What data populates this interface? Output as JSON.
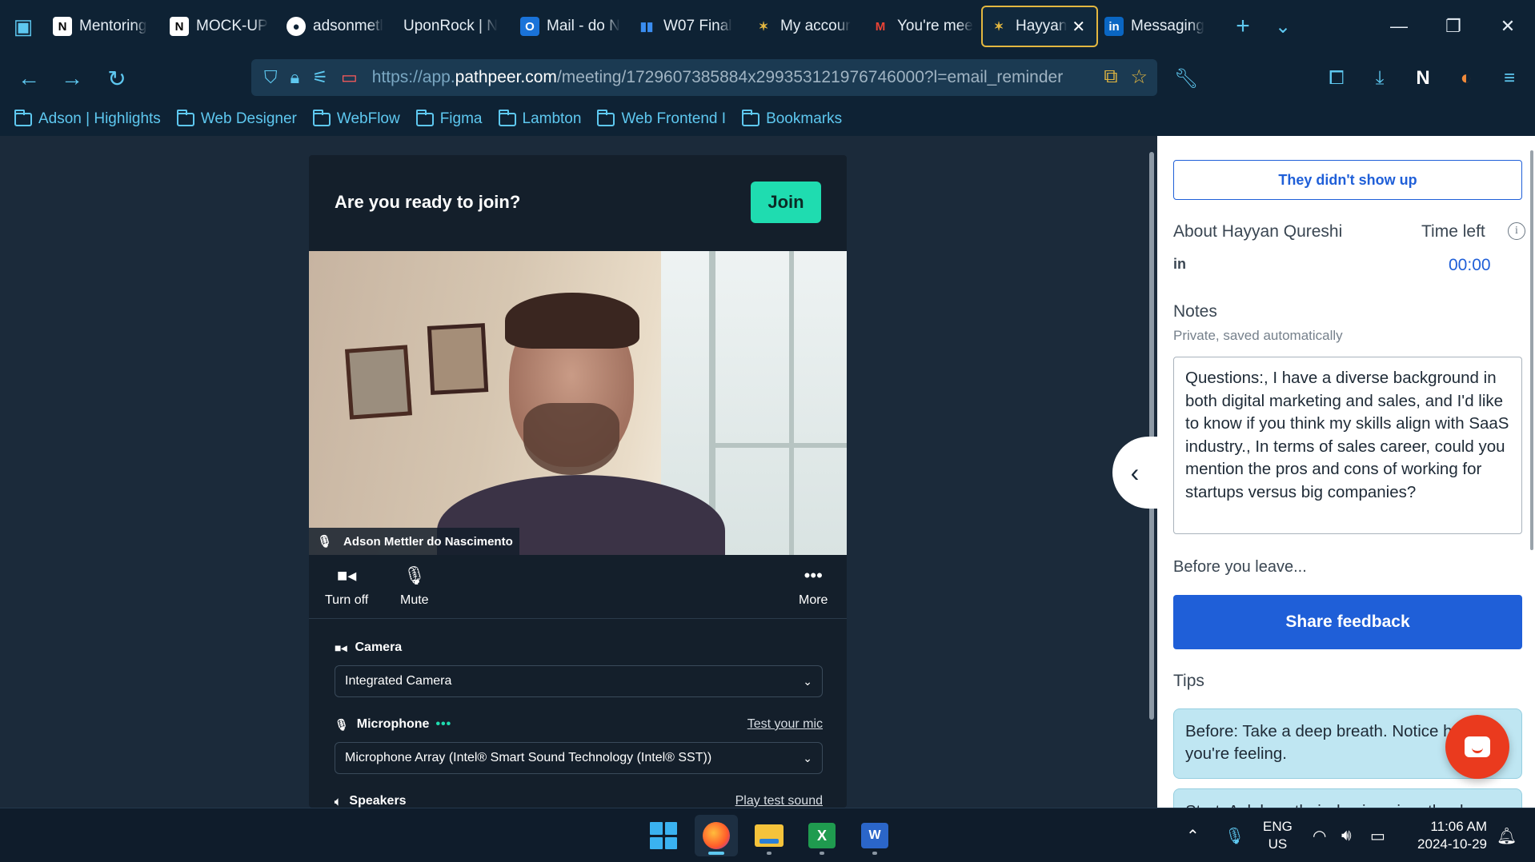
{
  "browser": {
    "tabs": [
      {
        "label": "Mentoring",
        "favicon": "notion-icon",
        "active": false
      },
      {
        "label": "MOCK-UP",
        "favicon": "notion-icon",
        "active": false
      },
      {
        "label": "adsonmetl",
        "favicon": "github-icon",
        "active": false
      },
      {
        "label": "UponRock | N",
        "favicon": "",
        "active": false
      },
      {
        "label": "Mail - do N",
        "favicon": "outlook-icon",
        "active": false
      },
      {
        "label": "W07 Final",
        "favicon": "chart-icon",
        "active": false
      },
      {
        "label": "My accour",
        "favicon": "pathpeer-icon",
        "active": false
      },
      {
        "label": "You're mee",
        "favicon": "gmail-icon",
        "active": false
      },
      {
        "label": "Hayyan",
        "favicon": "pathpeer-icon",
        "active": true
      },
      {
        "label": "Messaging",
        "favicon": "linkedin-icon",
        "active": false
      }
    ],
    "url_scheme": "https://app.",
    "url_domain": "pathpeer.com",
    "url_path": "/meeting/1729607385884x299353121976746000?l=email_reminder",
    "bookmarks": [
      "Adson | Highlights",
      "Web Designer",
      "WebFlow",
      "Figma",
      "Lambton",
      "Web Frontend I",
      "Bookmarks"
    ]
  },
  "prejoin": {
    "title": "Are you ready to join?",
    "join_label": "Join",
    "participant_name": "Adson Mettler do Nascimento",
    "controls": {
      "camera": "Turn off",
      "mic": "Mute",
      "more": "More"
    },
    "camera_label": "Camera",
    "camera_value": "Integrated Camera",
    "microphone_label": "Microphone",
    "microphone_link": "Test your mic",
    "microphone_value": "Microphone Array (Intel® Smart Sound Technology (Intel® SST))",
    "speakers_label": "Speakers",
    "speakers_link": "Play test sound"
  },
  "sidebar": {
    "no_show_label": "They didn't show up",
    "about_label": "About Hayyan  Qureshi",
    "time_left_label": "Time left",
    "time_left_value": "00:00",
    "notes_label": "Notes",
    "notes_sub": "Private, saved automatically",
    "notes_text": "Questions:, I have a diverse background in both digital marketing and sales, and I'd like to know if you think my skills align with SaaS industry., In terms of sales career, could you mention the pros and cons of working for startups versus big companies?",
    "before_leave_label": "Before you leave...",
    "feedback_label": "Share feedback",
    "tips_label": "Tips",
    "tips": [
      "Before: Take a deep breath. Notice how you're feeling.",
      "Start: Ask how their day is going, thank"
    ]
  },
  "taskbar": {
    "lang_top": "ENG",
    "lang_bottom": "US",
    "time": "11:06 AM",
    "date": "2024-10-29"
  },
  "colors": {
    "accent_join": "#1fdcb0",
    "primary_blue": "#1f5fd8",
    "chat_fab": "#ea3a1e"
  }
}
